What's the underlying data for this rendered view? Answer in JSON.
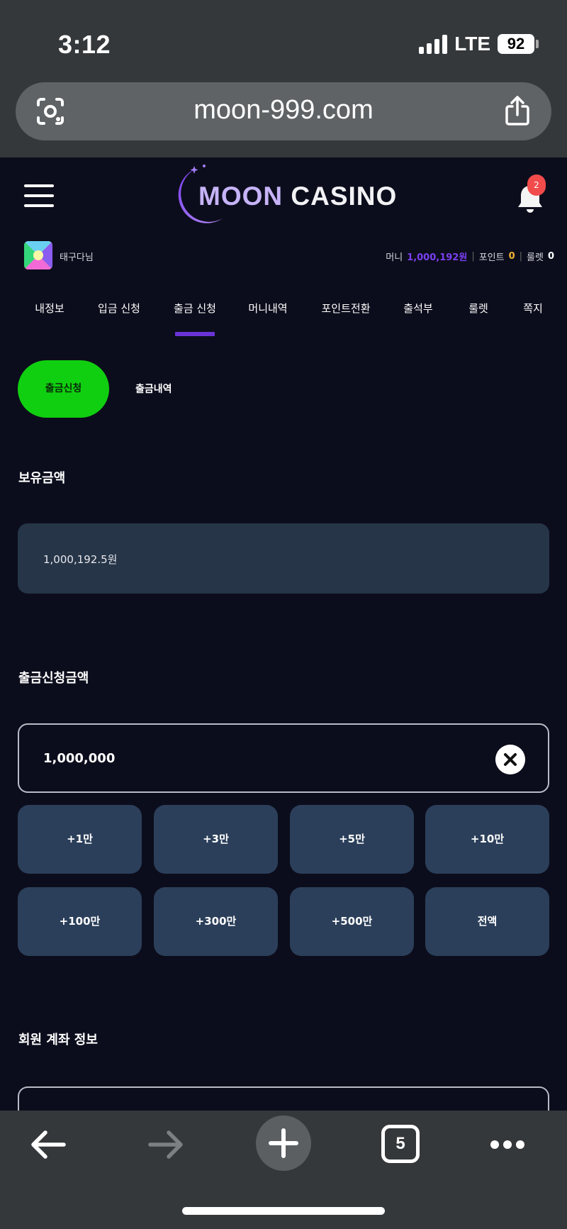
{
  "status_bar": {
    "time": "3:12",
    "network": "LTE",
    "battery": "92"
  },
  "browser": {
    "url": "moon-999.com",
    "open_tabs": "5"
  },
  "header": {
    "logo_moon": "MOON",
    "logo_casino": "CASINO",
    "notification_count": "2"
  },
  "user": {
    "name": "태구다님",
    "money_label": "머니",
    "money_value": "1,000,192원",
    "point_label": "포인트",
    "point_value": "0",
    "roulette_label": "룰렛",
    "roulette_value": "0"
  },
  "nav_tabs": [
    "내정보",
    "입금 신청",
    "출금 신청",
    "머니내역",
    "포인트전환",
    "출석부",
    "룰렛",
    "쪽지"
  ],
  "active_nav_tab": "출금 신청",
  "sub_tabs": {
    "active": "출금신청",
    "other": "출금내역"
  },
  "held_amount": {
    "title": "보유금액",
    "value": "1,000,192.5원"
  },
  "withdraw_amount": {
    "title": "출금신청금액",
    "value": "1,000,000"
  },
  "quick_buttons": [
    "+1만",
    "+3만",
    "+5만",
    "+10만",
    "+100만",
    "+300만",
    "+500만",
    "전액"
  ],
  "account_info": {
    "title": "회원 계좌 정보"
  },
  "colors": {
    "background": "#0c0d1c",
    "accent_purple": "#6a33d6",
    "active_green": "#10cf10",
    "panel": "#263548",
    "quick_button": "#2b3f5a",
    "point_orange": "#f2b233",
    "badge_red": "#f24b4b"
  }
}
